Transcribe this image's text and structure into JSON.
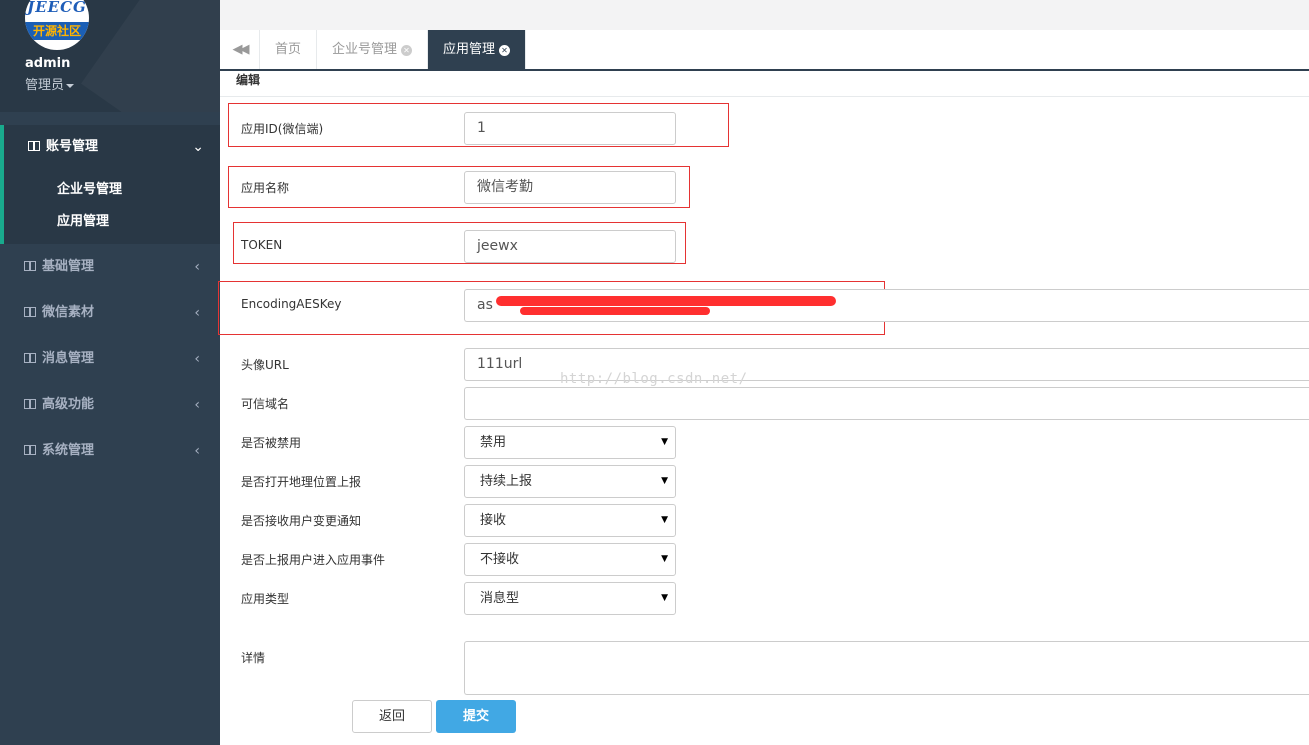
{
  "sidebar": {
    "logo": {
      "top_text": "JEECG",
      "band_text": "开源社区"
    },
    "profile": {
      "name": "admin",
      "role": "管理员"
    },
    "menu": [
      {
        "label": "账号管理",
        "expanded": true,
        "children": [
          "企业号管理",
          "应用管理"
        ]
      },
      {
        "label": "基础管理"
      },
      {
        "label": "微信素材"
      },
      {
        "label": "消息管理"
      },
      {
        "label": "高级功能"
      },
      {
        "label": "系统管理"
      }
    ]
  },
  "tabs": [
    {
      "label": "首页"
    },
    {
      "label": "企业号管理"
    },
    {
      "label": "应用管理",
      "active": true
    }
  ],
  "form": {
    "section_title": "编辑",
    "app_id": {
      "label": "应用ID(微信端)",
      "value": "1"
    },
    "app_name": {
      "label": "应用名称",
      "value": "微信考勤"
    },
    "token": {
      "label": "TOKEN",
      "value": "jeewx"
    },
    "aes_key": {
      "label": "EncodingAESKey",
      "value_prefix": "as"
    },
    "avatar_url": {
      "label": "头像URL",
      "value": "111url"
    },
    "trusted_domain": {
      "label": "可信域名",
      "value": ""
    },
    "disabled": {
      "label": "是否被禁用",
      "value": "禁用"
    },
    "report_location": {
      "label": "是否打开地理位置上报",
      "value": "持续上报"
    },
    "receive_change": {
      "label": "是否接收用户变更通知",
      "value": "接收"
    },
    "report_enter": {
      "label": "是否上报用户进入应用事件",
      "value": "不接收"
    },
    "app_type": {
      "label": "应用类型",
      "value": "消息型"
    },
    "details": {
      "label": "详情",
      "value": ""
    },
    "back_button": "返回",
    "submit_button": "提交"
  },
  "watermark": "http://blog.csdn.net/",
  "colors": {
    "sidebar_bg": "#2f4050",
    "accent_green": "#19aa8d",
    "submit_blue": "#41a8e4",
    "highlight_red": "#e53333"
  }
}
